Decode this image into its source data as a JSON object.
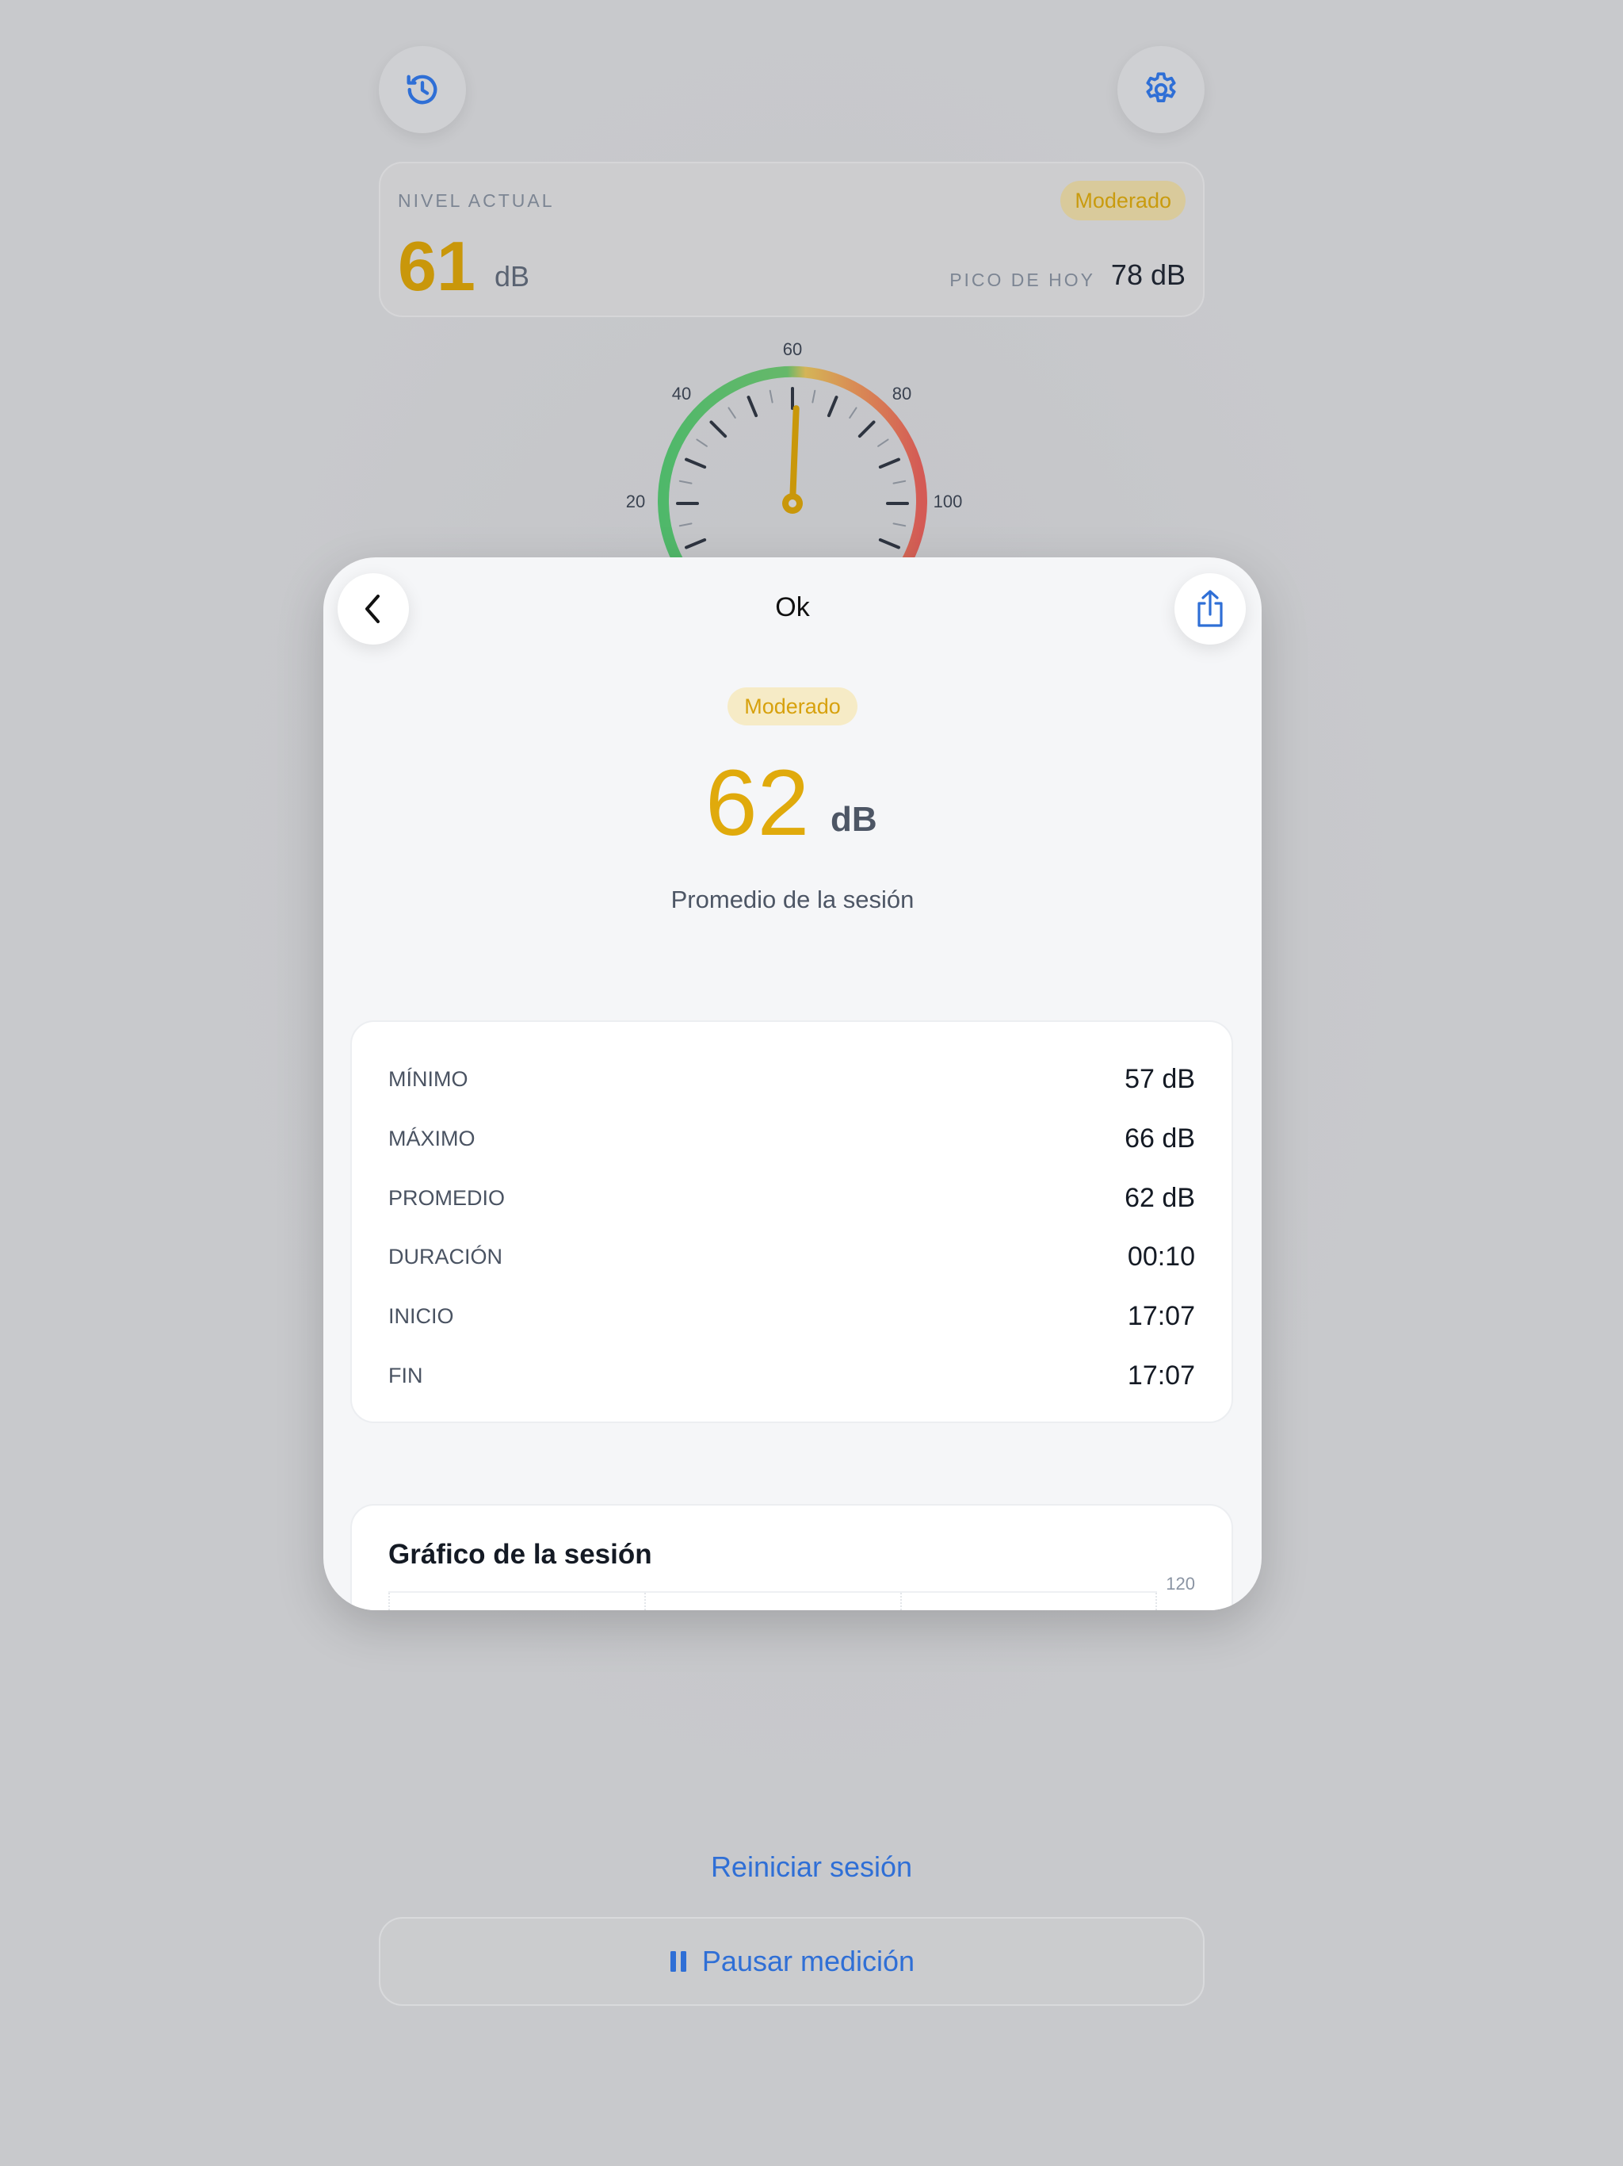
{
  "background": {
    "current_level": {
      "label": "NIVEL ACTUAL",
      "badge": "Moderado",
      "value": "61",
      "unit": "dB",
      "peak_label": "PICO DE HOY",
      "peak_value": "78 dB"
    },
    "gauge": {
      "ticks": [
        "20",
        "40",
        "60",
        "80",
        "100"
      ],
      "value": 61
    },
    "restart_label": "Reiniciar sesión",
    "pause_label": "Pausar medición"
  },
  "sheet": {
    "title": "Ok",
    "badge": "Moderado",
    "average_value": "62",
    "average_unit": "dB",
    "average_caption": "Promedio de la sesión",
    "stats": [
      {
        "label": "MÍNIMO",
        "value": "57 dB"
      },
      {
        "label": "MÁXIMO",
        "value": "66 dB"
      },
      {
        "label": "PROMEDIO",
        "value": "62 dB"
      },
      {
        "label": "DURACIÓN",
        "value": "00:10"
      },
      {
        "label": "INICIO",
        "value": "17:07"
      },
      {
        "label": "FIN",
        "value": "17:07"
      }
    ],
    "chart": {
      "title": "Gráfico de la sesión",
      "axis_max": "120"
    }
  },
  "colors": {
    "accent_blue": "#2f6fd6",
    "moderate_yellow": "#e0aa0c",
    "gauge_green": "#4fb86a",
    "gauge_red": "#d9534f"
  }
}
